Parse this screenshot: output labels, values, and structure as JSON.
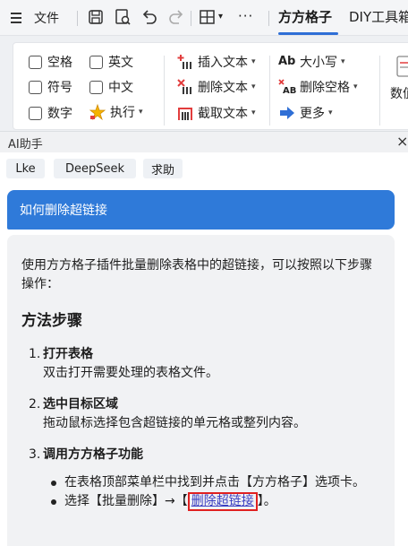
{
  "menubar": {
    "file_label": "文件",
    "active_tab": "方方格子",
    "next_tab": "DIY工具箱",
    "more_label": "···",
    "icons": [
      "menu-icon",
      "save-icon",
      "print-preview-icon",
      "undo-icon",
      "redo-icon",
      "table-icon",
      "more-icon"
    ]
  },
  "ribbon": {
    "checkboxes": {
      "space": "空格",
      "english": "英文",
      "symbol": "符号",
      "chinese": "中文",
      "number": "数字"
    },
    "execute_label": "执行",
    "insert_text": "插入文本",
    "delete_text": "删除文本",
    "extract_text": "截取文本",
    "case_label": "大小写",
    "delete_space": "删除空格",
    "more_label": "更多",
    "number_label": "数值"
  },
  "ai_panel": {
    "title": "AI助手",
    "close_label": "×",
    "tabs": [
      "Lke",
      "DeepSeek",
      "求助"
    ],
    "question": "如何删除超链接",
    "answer": {
      "intro": "使用方方格子插件批量删除表格中的超链接，可以按照以下步骤操作：",
      "heading": "方法步骤",
      "steps": [
        {
          "num": "1.",
          "title": "打开表格",
          "desc": "双击打开需要处理的表格文件。"
        },
        {
          "num": "2.",
          "title": "选中目标区域",
          "desc": "拖动鼠标选择包含超链接的单元格或整列内容。"
        },
        {
          "num": "3.",
          "title": "调用方方格子功能",
          "desc": ""
        }
      ],
      "bullets": {
        "b1": "在表格顶部菜单栏中找到并点击【方方格子】选项卡。",
        "b2_prefix": "选择【批量删除】→【",
        "b2_link": "删除超链接",
        "b2_suffix": "】。"
      }
    }
  },
  "colors": {
    "accent": "#2f7ad9",
    "tab_underline": "#2f6fd6",
    "highlight_border": "#e02020",
    "link": "#3a3fc2"
  }
}
